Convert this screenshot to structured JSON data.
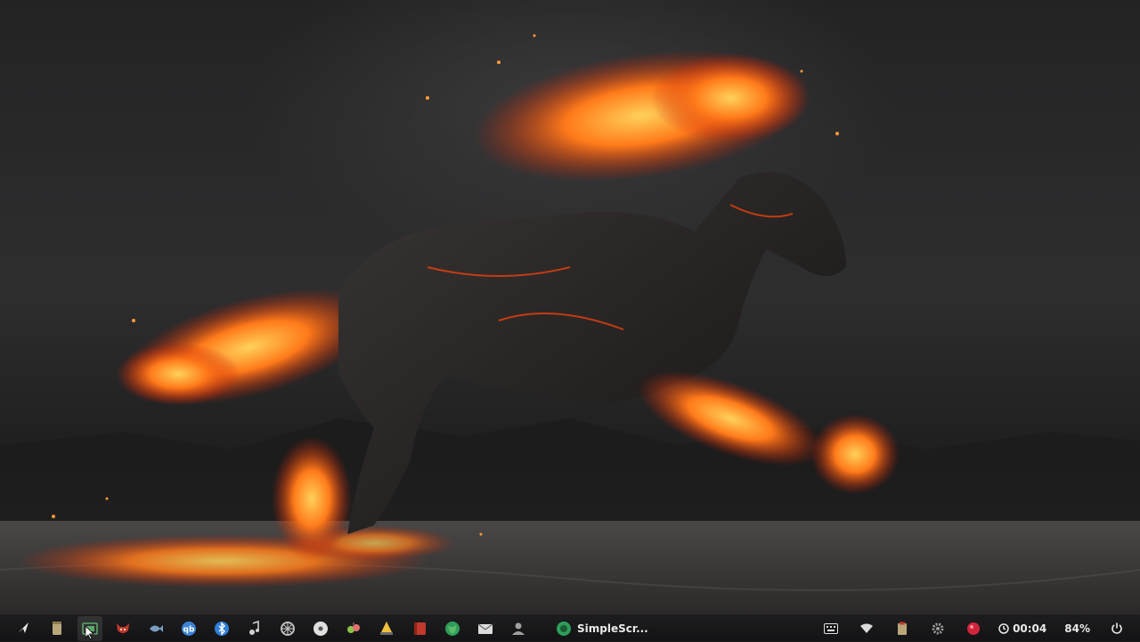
{
  "desktop": {
    "wallpaper": "fire-horse-wallpaper",
    "colors": {
      "sky": "#2e2e2f",
      "fire": "#ff5a12",
      "ember": "#ffae3b"
    }
  },
  "taskbar": {
    "launchers": [
      {
        "name": "launcher-menu-icon",
        "color": "#e8e8e8"
      },
      {
        "name": "file-manager-icon",
        "color": "#b8a77a"
      },
      {
        "name": "screenshot-tool-icon",
        "color": "#5aa86a"
      },
      {
        "name": "fox-app-icon",
        "color": "#c0392b"
      },
      {
        "name": "fish-app-icon",
        "color": "#7a9cc0"
      },
      {
        "name": "qbittorrent-icon",
        "color": "#3b82d6"
      },
      {
        "name": "bluetooth-icon",
        "color": "#2f7fd8"
      },
      {
        "name": "audio-player-icon",
        "color": "#cfcfcf"
      },
      {
        "name": "settings-wheel-icon",
        "color": "#bdbdbd"
      },
      {
        "name": "disc-burner-icon",
        "color": "#e0e0e0"
      },
      {
        "name": "game-app-icon",
        "color": "#8bc34a"
      },
      {
        "name": "installer-icon",
        "color": "#f0c040"
      },
      {
        "name": "red-notebook-icon",
        "color": "#c0392b"
      },
      {
        "name": "globe-browser-icon",
        "color": "#2e9e5a"
      },
      {
        "name": "mail-app-icon",
        "color": "#dcdcdc"
      },
      {
        "name": "user-profile-icon",
        "color": "#a0a0a0"
      }
    ],
    "active_task": {
      "label": "SimpleScr...",
      "icon": "simplescreenrecorder-icon"
    },
    "tray": {
      "items": [
        {
          "name": "keyboard-icon"
        },
        {
          "name": "wifi-icon"
        },
        {
          "name": "clipboard-icon"
        },
        {
          "name": "gear-tray-icon"
        },
        {
          "name": "record-stop-icon",
          "color": "#d0243c"
        }
      ],
      "clock": "00:04",
      "battery": "84%"
    }
  }
}
